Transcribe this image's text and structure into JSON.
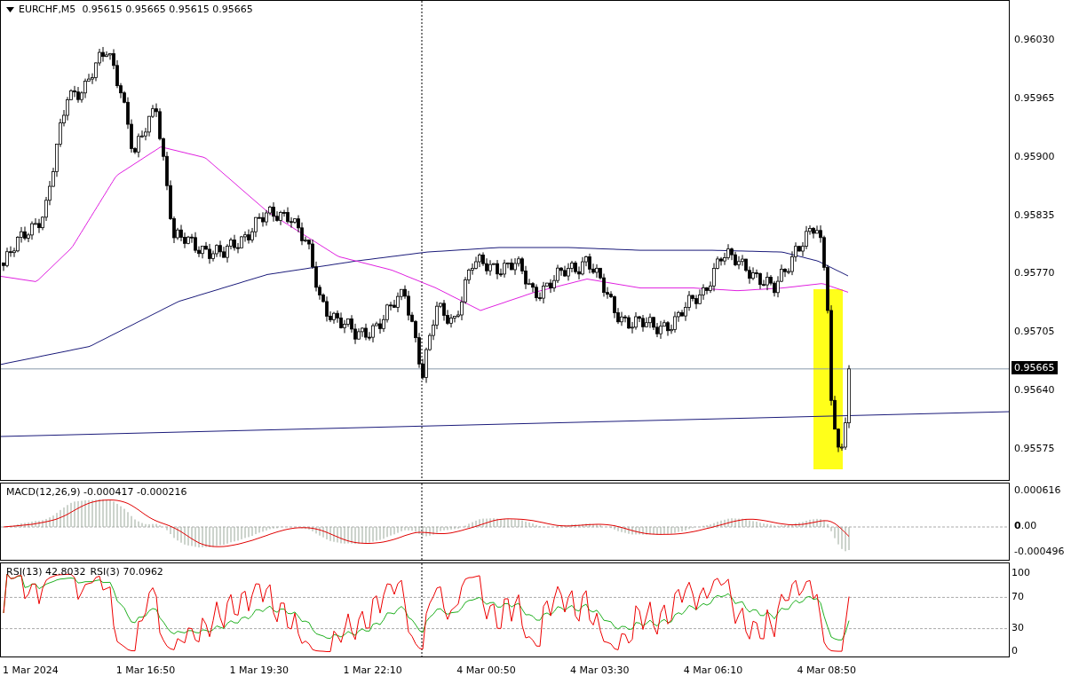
{
  "chart": {
    "symbol": "EURCHF,M5",
    "ohlc": [
      "0.95615",
      "0.95665",
      "0.95615",
      "0.95665"
    ]
  },
  "price_axis": [
    "0.96030",
    "0.95965",
    "0.95900",
    "0.95835",
    "0.95770",
    "0.95705",
    "0.95640",
    "0.95575"
  ],
  "current_price": "0.95665",
  "macd": {
    "label": "MACD(12,26,9)",
    "values": [
      "-0.000417",
      "-0.000216"
    ],
    "axis": [
      "0.000616",
      "**0**.00",
      "-0.000496"
    ]
  },
  "rsi": {
    "labels": [
      "RSI(13) 42.8032",
      "RSI(3) 70.0962"
    ],
    "axis": [
      "100",
      "70",
      "30",
      "0"
    ]
  },
  "time_axis": [
    "1 Mar 2024",
    "1 Mar 16:50",
    "1 Mar 19:30",
    "1 Mar 22:10",
    "4 Mar 00:50",
    "4 Mar 03:30",
    "4 Mar 06:10",
    "4 Mar 08:50"
  ]
}
